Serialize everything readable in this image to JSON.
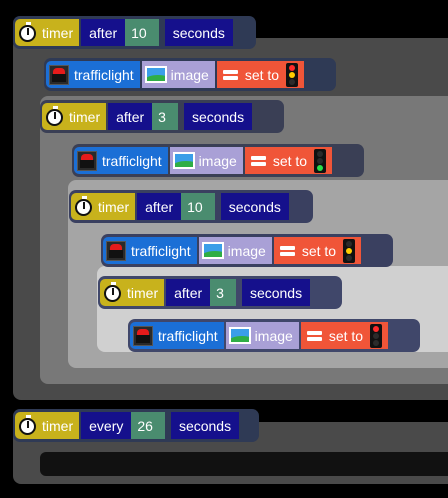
{
  "workspace": {
    "timer_label": "timer",
    "blocks": [
      {
        "kind": "timer",
        "mode": "after",
        "value": "10",
        "unit": "seconds"
      },
      {
        "kind": "set",
        "object": "trafficlight",
        "property": "image",
        "op": "set to",
        "light": "red-amber"
      },
      {
        "kind": "timer",
        "mode": "after",
        "value": "3",
        "unit": "seconds"
      },
      {
        "kind": "set",
        "object": "trafficlight",
        "property": "image",
        "op": "set to",
        "light": "green"
      },
      {
        "kind": "timer",
        "mode": "after",
        "value": "10",
        "unit": "seconds"
      },
      {
        "kind": "set",
        "object": "trafficlight",
        "property": "image",
        "op": "set to",
        "light": "yellow"
      },
      {
        "kind": "timer",
        "mode": "after",
        "value": "3",
        "unit": "seconds"
      },
      {
        "kind": "set",
        "object": "trafficlight",
        "property": "image",
        "op": "set to",
        "light": "red"
      },
      {
        "kind": "timer",
        "mode": "every",
        "value": "26",
        "unit": "seconds"
      }
    ]
  },
  "icons": {
    "timer": "stopwatch-icon",
    "object": "traffic-light-icon",
    "property": "picture-icon",
    "operator": "equals-icon"
  },
  "colors": {
    "timer": "#c8b21c",
    "keyword": "#15108c",
    "number": "#4a8c6f",
    "object": "#1b6fd6",
    "property": "#a9a0d6",
    "operator": "#f05538"
  }
}
